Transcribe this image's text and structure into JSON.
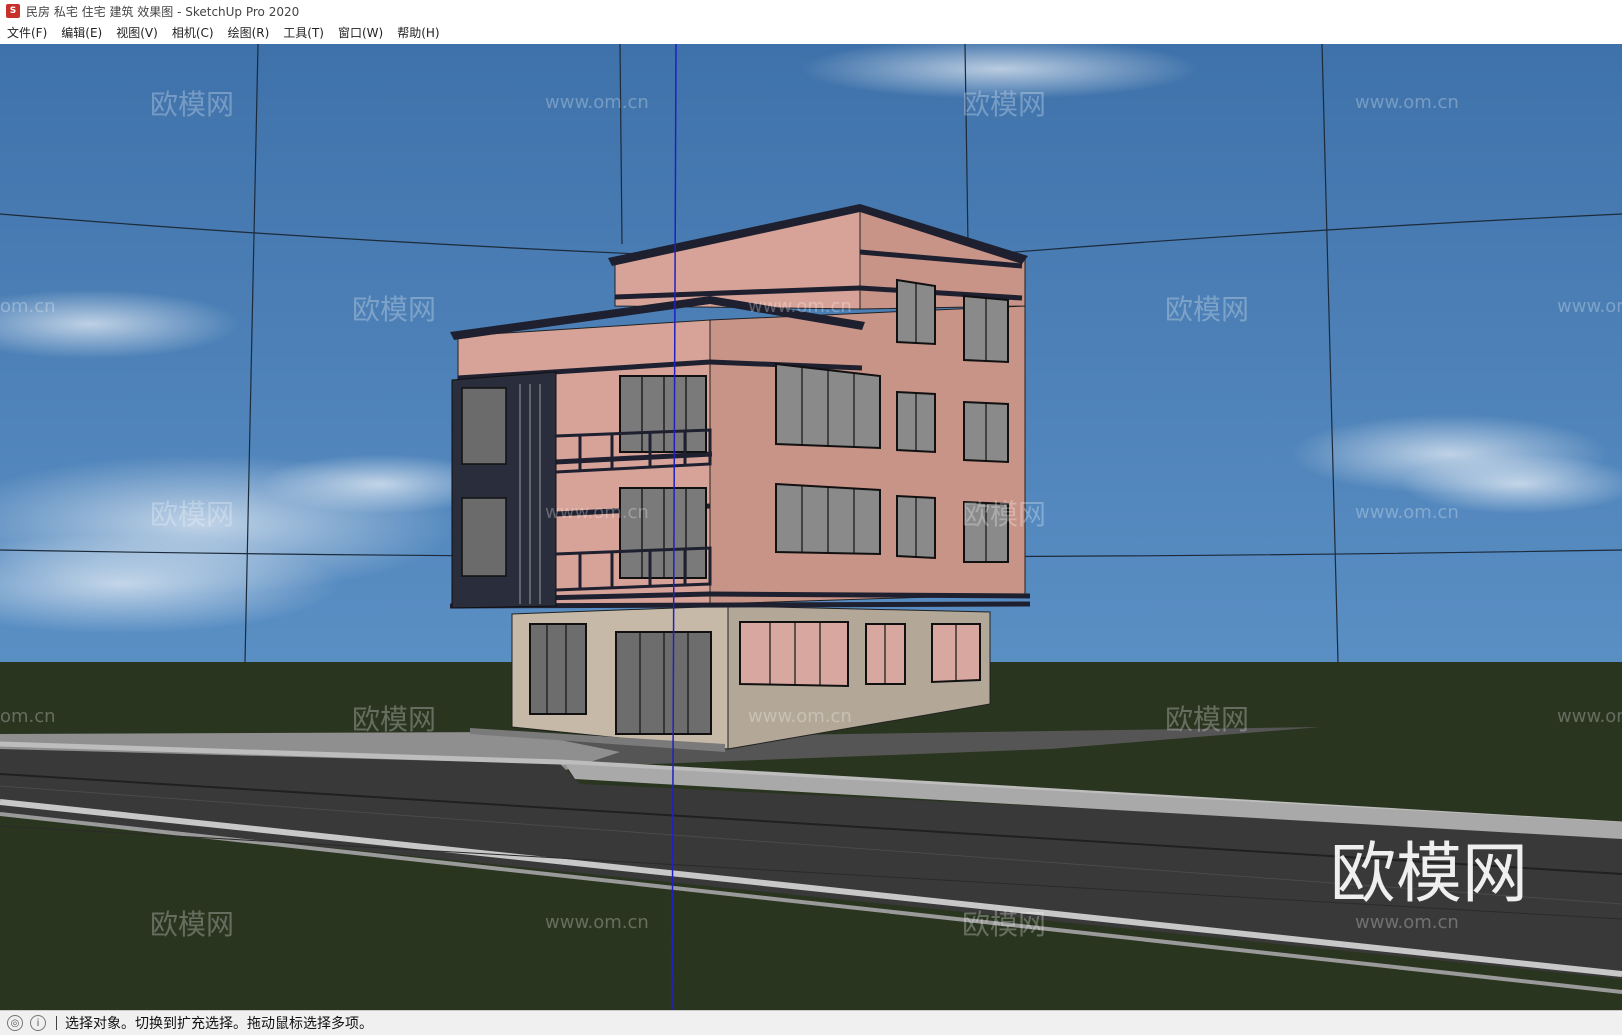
{
  "window": {
    "title": "民房 私宅 住宅 建筑 效果图 - SketchUp Pro 2020",
    "icon": "sketchup-logo-icon"
  },
  "menu": [
    {
      "label": "文件(F)"
    },
    {
      "label": "编辑(E)"
    },
    {
      "label": "视图(V)"
    },
    {
      "label": "相机(C)"
    },
    {
      "label": "绘图(R)"
    },
    {
      "label": "工具(T)"
    },
    {
      "label": "窗口(W)"
    },
    {
      "label": "帮助(H)"
    }
  ],
  "viewport": {
    "scene": "3d-model-building",
    "watermark_cn": "欧模网",
    "watermark_url": "www.om.cn",
    "watermark_url_partial": "om.cn",
    "watermark_large": "欧模网",
    "colors": {
      "sky": "#4a7fb5",
      "ground": "#2b3a1f",
      "road": "#3a3a3a",
      "wall": "#d8a59a",
      "base": "#bfb5a6",
      "frame": "#1e2030",
      "axis_blue": "#2020c0"
    }
  },
  "status": {
    "message": "选择对象。切换到扩充选择。拖动鼠标选择多项。",
    "icons": [
      "geo-location-icon",
      "info-icon"
    ]
  }
}
